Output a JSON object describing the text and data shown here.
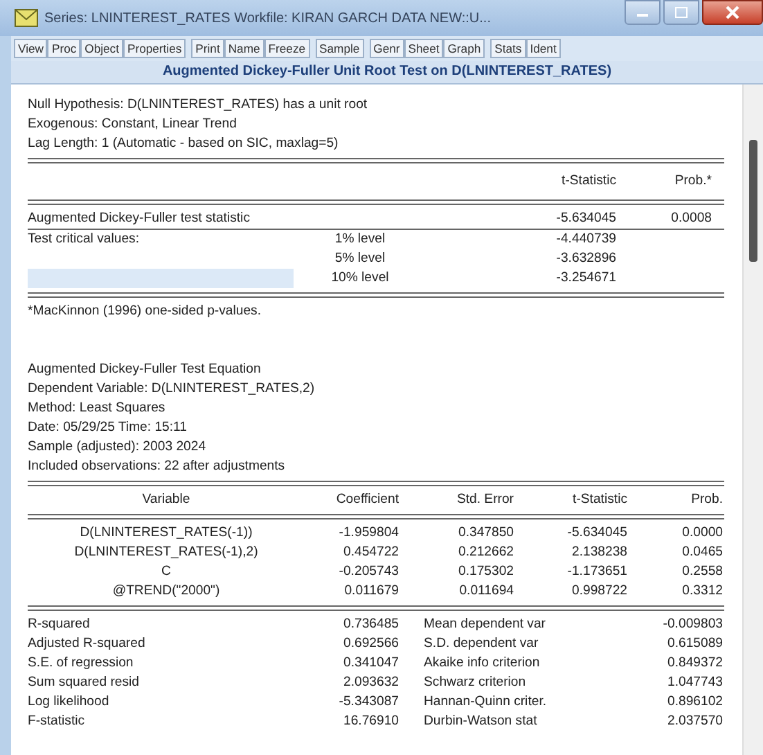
{
  "window": {
    "title": "Series: LNINTEREST_RATES   Workfile: KIRAN GARCH DATA NEW::U..."
  },
  "toolbar": [
    "View",
    "Proc",
    "Object",
    "Properties",
    "Print",
    "Name",
    "Freeze",
    "Sample",
    "Genr",
    "Sheet",
    "Graph",
    "Stats",
    "Ident"
  ],
  "heading": "Augmented Dickey-Fuller Unit Root Test on D(LNINTEREST_RATES)",
  "test_info": [
    "Null Hypothesis: D(LNINTEREST_RATES) has a unit root",
    "Exogenous: Constant, Linear Trend",
    "Lag Length: 1 (Automatic - based on SIC, maxlag=5)"
  ],
  "test_table": {
    "columns": [
      "t-Statistic",
      "Prob.*"
    ],
    "statistic": {
      "label": "Augmented Dickey-Fuller test statistic",
      "t_statistic": "-5.634045",
      "prob": "0.0008"
    },
    "critical_values": [
      {
        "label": "Test critical values:",
        "level": "1% level",
        "value": "-4.440739",
        "selected": false
      },
      {
        "level": "5% level",
        "value": "-3.632896",
        "selected": false
      },
      {
        "level": "10% level",
        "value": "-3.254671",
        "selected": true
      }
    ],
    "footnote": "*MacKinnon (1996) one-sided p-values."
  },
  "equation_info": [
    "Augmented Dickey-Fuller Test Equation",
    "Dependent Variable: D(LNINTEREST_RATES,2)",
    "Method: Least Squares",
    "Date: 05/29/25   Time: 15:11",
    "Sample (adjusted): 2003 2024",
    "Included observations: 22 after adjustments"
  ],
  "coef_table": {
    "columns": [
      "Variable",
      "Coefficient",
      "Std. Error",
      "t-Statistic",
      "Prob."
    ],
    "rows": [
      [
        "D(LNINTEREST_RATES(-1))",
        "-1.959804",
        "0.347850",
        "-5.634045",
        "0.0000"
      ],
      [
        "D(LNINTEREST_RATES(-1),2)",
        "0.454722",
        "0.212662",
        "2.138238",
        "0.0465"
      ],
      [
        "C",
        "-0.205743",
        "0.175302",
        "-1.173651",
        "0.2558"
      ],
      [
        "@TREND(\"2000\")",
        "0.011679",
        "0.011694",
        "0.998722",
        "0.3312"
      ]
    ]
  },
  "summary_stats": [
    [
      "R-squared",
      "0.736485",
      "Mean dependent var",
      "-0.009803"
    ],
    [
      "Adjusted R-squared",
      "0.692566",
      "S.D. dependent var",
      "0.615089"
    ],
    [
      "S.E. of regression",
      "0.341047",
      "Akaike info criterion",
      "0.849372"
    ],
    [
      "Sum squared resid",
      "2.093632",
      "Schwarz criterion",
      "1.047743"
    ],
    [
      "Log likelihood",
      "-5.343087",
      "Hannan-Quinn criter.",
      "0.896102"
    ],
    [
      "F-statistic",
      "16.76910",
      "Durbin-Watson stat",
      "2.037570"
    ]
  ]
}
